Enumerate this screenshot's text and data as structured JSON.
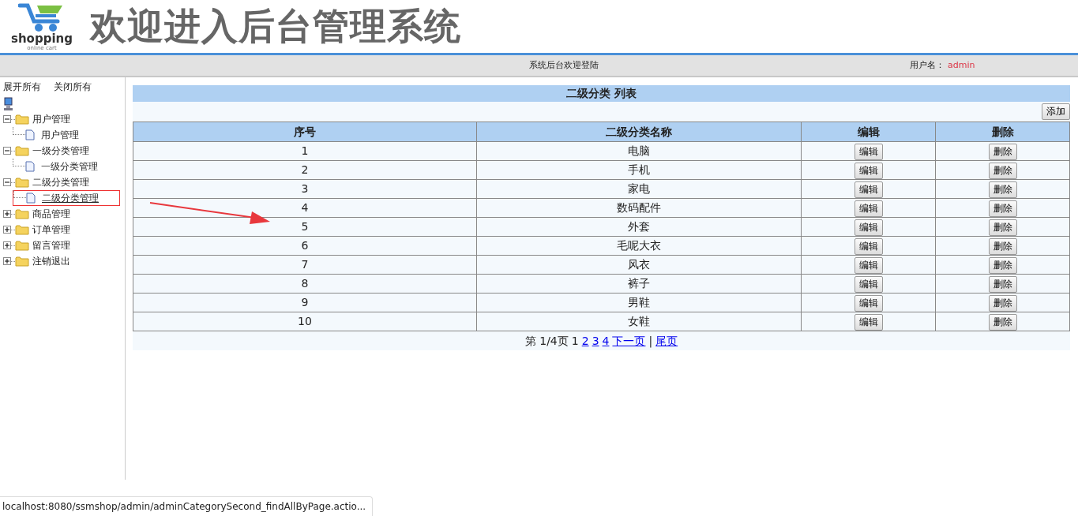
{
  "header": {
    "logo_text": "shopping",
    "logo_subtext": "online cart",
    "title": "欢迎进入后台管理系统"
  },
  "top_bar": {
    "welcome": "系统后台欢迎登陆",
    "user_label": "用户名：",
    "user_name": "admin"
  },
  "sidebar": {
    "expand_all": "展开所有",
    "collapse_all": "关闭所有",
    "tree": [
      {
        "label": "用户管理",
        "expanded": true,
        "children": [
          {
            "label": "用户管理",
            "selected": false
          }
        ]
      },
      {
        "label": "一级分类管理",
        "expanded": true,
        "children": [
          {
            "label": "一级分类管理",
            "selected": false
          }
        ]
      },
      {
        "label": "二级分类管理",
        "expanded": true,
        "children": [
          {
            "label": "二级分类管理",
            "selected": true
          }
        ]
      },
      {
        "label": "商品管理",
        "expanded": false
      },
      {
        "label": "订单管理",
        "expanded": false
      },
      {
        "label": "留言管理",
        "expanded": false
      },
      {
        "label": "注销退出",
        "expanded": false
      }
    ]
  },
  "content": {
    "title": "二级分类 列表",
    "add_button": "添加",
    "table": {
      "columns": [
        "序号",
        "二级分类名称",
        "编辑",
        "删除"
      ],
      "rows": [
        {
          "index": "1",
          "name": "电脑",
          "edit": "编辑",
          "delete": "删除"
        },
        {
          "index": "2",
          "name": "手机",
          "edit": "编辑",
          "delete": "删除"
        },
        {
          "index": "3",
          "name": "家电",
          "edit": "编辑",
          "delete": "删除"
        },
        {
          "index": "4",
          "name": "数码配件",
          "edit": "编辑",
          "delete": "删除"
        },
        {
          "index": "5",
          "name": "外套",
          "edit": "编辑",
          "delete": "删除"
        },
        {
          "index": "6",
          "name": "毛呢大衣",
          "edit": "编辑",
          "delete": "删除"
        },
        {
          "index": "7",
          "name": "风衣",
          "edit": "编辑",
          "delete": "删除"
        },
        {
          "index": "8",
          "name": "裤子",
          "edit": "编辑",
          "delete": "删除"
        },
        {
          "index": "9",
          "name": "男鞋",
          "edit": "编辑",
          "delete": "删除"
        },
        {
          "index": "10",
          "name": "女鞋",
          "edit": "编辑",
          "delete": "删除"
        }
      ]
    },
    "pagination": {
      "summary": "第 1/4页",
      "pages": [
        {
          "label": "1",
          "selected": true
        },
        {
          "label": "2",
          "selected": false
        },
        {
          "label": "3",
          "selected": false
        },
        {
          "label": "4",
          "selected": false
        }
      ],
      "next": "下一页",
      "separator": "|",
      "last": "尾页"
    }
  },
  "status_bar": {
    "url": "localhost:8080/ssmshop/admin/adminCategorySecond_findAllByPage.actio..."
  }
}
